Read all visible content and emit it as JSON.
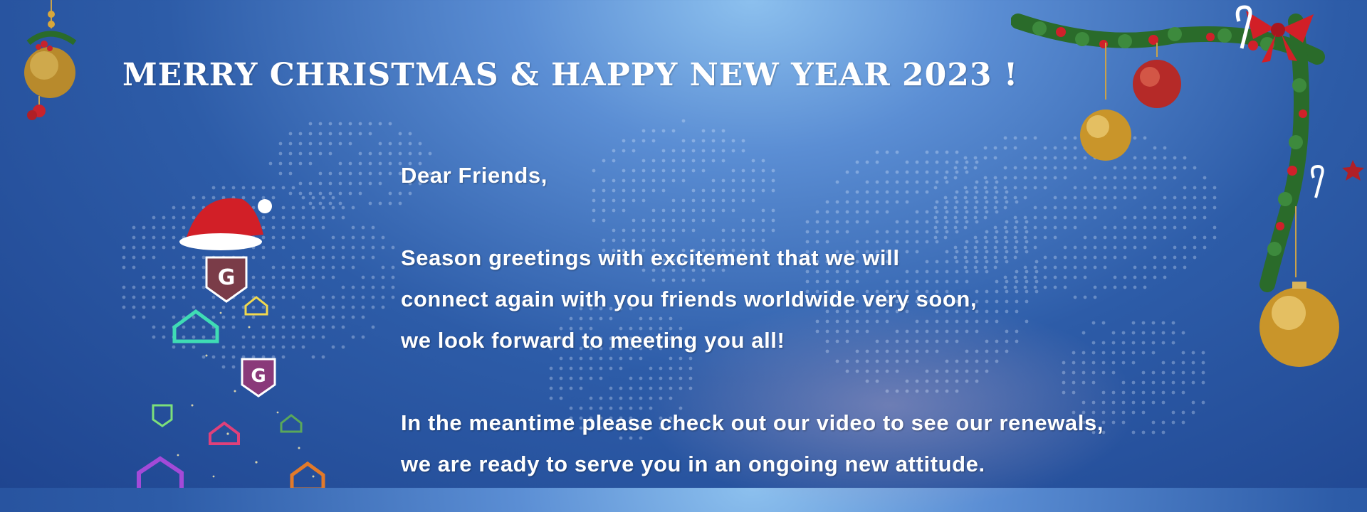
{
  "banner": {
    "title": "MERRY CHRISTMAS & HAPPY NEW YEAR 2023 !",
    "greeting": "Dear Friends,",
    "paragraph1": [
      "Season greetings with excitement that we will",
      "connect again with you friends worldwide very soon,",
      "we look forward to meeting you all!"
    ],
    "paragraph2": [
      "In the meantime please check out our video to see our renewals,",
      "we are ready to serve you in an ongoing new attitude."
    ]
  },
  "colors": {
    "text": "#ffffff",
    "bg_top": "#8cc0ee",
    "bg_bottom": "#1f4590",
    "gold": "#d8a73a",
    "red": "#c8232c",
    "green": "#2a6b2a"
  },
  "icons": {
    "tree": "logo-christmas-tree-icon",
    "santa_hat": "santa-hat-icon",
    "ornament": "christmas-ornament-icon",
    "garland": "holly-garland-icon"
  }
}
